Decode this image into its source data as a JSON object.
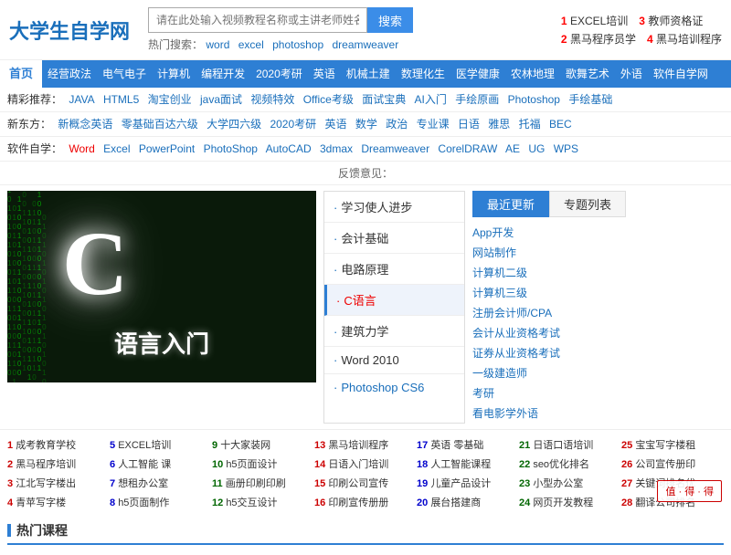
{
  "header": {
    "logo": "大学生自学网",
    "search_placeholder": "请在此处输入视频教程名称或主讲老师姓名",
    "search_btn": "搜索",
    "hot_label": "热门搜索：",
    "hot_links": [
      "word",
      "excel",
      "photoshop",
      "dreamweaver"
    ],
    "right_links": [
      {
        "num": "1",
        "text": "EXCEL培训",
        "num2": "3",
        "text2": "教师资格证"
      },
      {
        "num": "2",
        "text": "黑马程序员学",
        "num2": "4",
        "text2": "黑马培训程序"
      }
    ]
  },
  "nav": {
    "items": [
      "首页",
      "经营政法",
      "电气电子",
      "计算机",
      "编程开发",
      "2020考研",
      "英语",
      "机械土建",
      "数理化生",
      "医学健康",
      "农林地理",
      "歌舞艺术",
      "外语",
      "软件自学网"
    ]
  },
  "sub_nav": {
    "row1_label": "精彩推荐：",
    "row1_items": [
      "JAVA",
      "HTML5",
      "淘宝创业",
      "java面试",
      "视频特效",
      "Office考级",
      "面试宝典",
      "AI入门",
      "手绘原画",
      "Photoshop",
      "手绘基础"
    ],
    "row2_label": "新东方：",
    "row2_items": [
      "新概念英语",
      "零基础百达六级",
      "大学四六级",
      "2020考研",
      "英语",
      "数学",
      "政治",
      "专业课",
      "日语",
      "雅思",
      "托福",
      "BEC"
    ],
    "row3_label": "软件自学：",
    "row3_items": [
      "Word",
      "Excel",
      "PowerPoint",
      "PhotoShop",
      "AutoCAD",
      "3dmax",
      "Dreamweaver",
      "CorelDRAW",
      "AE",
      "UG",
      "WPS"
    ]
  },
  "feedback": "反馈意见：",
  "banner": {
    "c_char": "C",
    "text": "语言入门"
  },
  "middle_list": {
    "items": [
      {
        "text": "学习使人进步",
        "active": false
      },
      {
        "text": "会计基础",
        "active": false
      },
      {
        "text": "电路原理",
        "active": false
      },
      {
        "text": "C语言",
        "active": true
      },
      {
        "text": "建筑力学",
        "active": false
      },
      {
        "text": "Word 2010",
        "active": false
      },
      {
        "text": "Photoshop CS6",
        "active": false
      }
    ]
  },
  "right_panel": {
    "tabs": [
      "最近更新",
      "专题列表"
    ],
    "active_tab": 0,
    "items": [
      "App开发",
      "网站制作",
      "计算机二级",
      "计算机三级",
      "注册会计师/CPA",
      "会计从业资格考试",
      "证券从业资格考试",
      "一级建造师",
      "考研",
      "看电影学外语"
    ]
  },
  "bottom_links": [
    {
      "num": "1",
      "color": "red",
      "text": "成考教育学校"
    },
    {
      "num": "5",
      "color": "blue",
      "text": "EXCEL培训"
    },
    {
      "num": "9",
      "color": "green",
      "text": "十大家装网"
    },
    {
      "num": "13",
      "color": "red",
      "text": "黑马培训程序"
    },
    {
      "num": "17",
      "color": "blue",
      "text": "英语 零基础"
    },
    {
      "num": "21",
      "color": "green",
      "text": "日语口语培训"
    },
    {
      "num": "25",
      "color": "red",
      "text": "宝宝写字楼租"
    },
    {
      "num": "2",
      "color": "red",
      "text": "黑马程序培训"
    },
    {
      "num": "6",
      "color": "blue",
      "text": "人工智能 课"
    },
    {
      "num": "10",
      "color": "green",
      "text": "h5页面设计"
    },
    {
      "num": "14",
      "color": "red",
      "text": "日语入门培训"
    },
    {
      "num": "18",
      "color": "blue",
      "text": "人工智能课程"
    },
    {
      "num": "22",
      "color": "green",
      "text": "seo优化排名"
    },
    {
      "num": "26",
      "color": "red",
      "text": "公司宣传册印"
    },
    {
      "num": "3",
      "color": "red",
      "text": "江北写字楼出"
    },
    {
      "num": "7",
      "color": "blue",
      "text": "想租办公室"
    },
    {
      "num": "11",
      "color": "green",
      "text": "画册印刷印刷"
    },
    {
      "num": "15",
      "color": "red",
      "text": "印刷公司宣传"
    },
    {
      "num": "19",
      "color": "blue",
      "text": "儿童产品设计"
    },
    {
      "num": "23",
      "color": "green",
      "text": "小型办公室"
    },
    {
      "num": "27",
      "color": "red",
      "text": "关键词排名优"
    },
    {
      "num": "4",
      "color": "red",
      "text": "青苹写字楼"
    },
    {
      "num": "8",
      "color": "blue",
      "text": "h5页面制作"
    },
    {
      "num": "12",
      "color": "green",
      "text": "h5交互设计"
    },
    {
      "num": "16",
      "color": "red",
      "text": "印刷宣传册册"
    },
    {
      "num": "20",
      "color": "blue",
      "text": "展台搭建商"
    },
    {
      "num": "24",
      "color": "green",
      "text": "网页开发教程"
    },
    {
      "num": "28",
      "color": "red",
      "text": "翻译公司排名"
    }
  ],
  "hot_courses_title": "热门课程",
  "watermark": "值 · 得 · 得"
}
